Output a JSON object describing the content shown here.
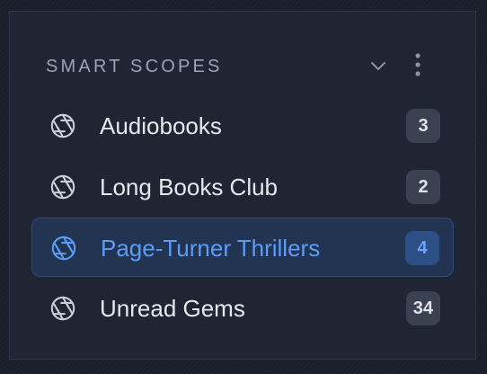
{
  "section": {
    "title": "SMART SCOPES",
    "chevron_icon": "chevron-down-icon",
    "menu_icon": "kebab-menu-icon"
  },
  "items": [
    {
      "label": "Audiobooks",
      "count": "3",
      "icon": "aperture-icon",
      "active": false
    },
    {
      "label": "Long Books Club",
      "count": "2",
      "icon": "aperture-icon",
      "active": false
    },
    {
      "label": "Page-Turner Thrillers",
      "count": "4",
      "icon": "aperture-icon",
      "active": true
    },
    {
      "label": "Unread Gems",
      "count": "34",
      "icon": "aperture-icon",
      "active": false
    }
  ],
  "colors": {
    "background": "#1a202b",
    "panel": "#1f2533",
    "text": "#e5e8ef",
    "muted": "#9aa3b5",
    "accent": "#5b9cf6",
    "active_bg": "#233452",
    "badge_bg": "#3a4150"
  }
}
